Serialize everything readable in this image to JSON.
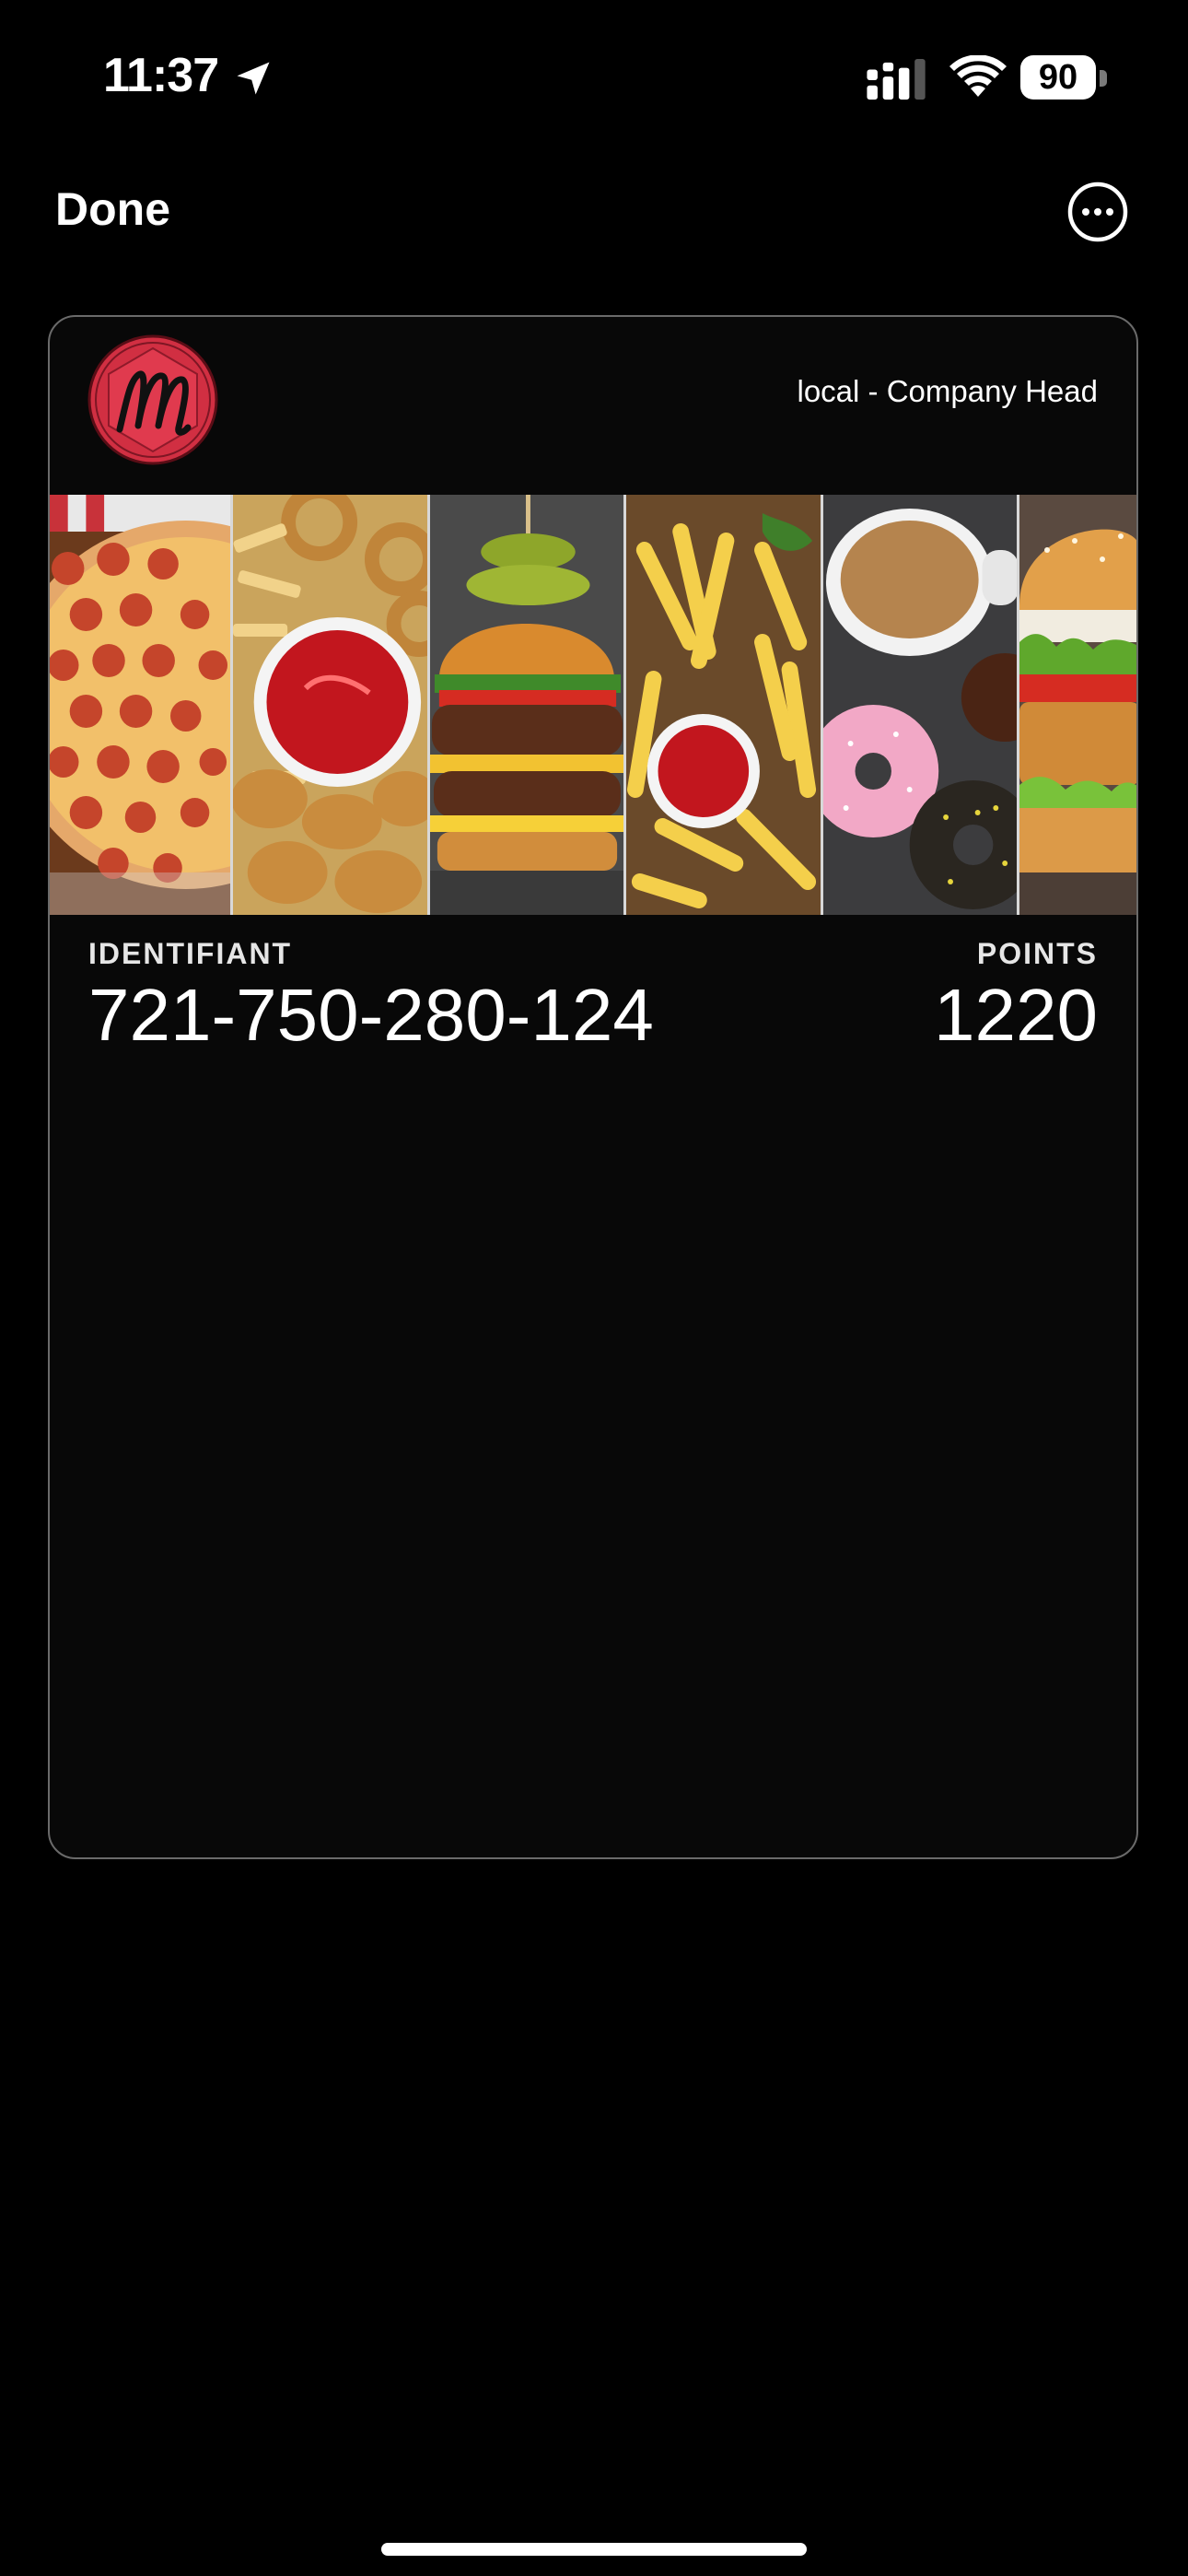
{
  "status_bar": {
    "time": "11:37",
    "battery": "90",
    "icons": [
      "location-arrow-icon",
      "cellular-signal-icon",
      "wifi-icon",
      "battery-icon"
    ]
  },
  "nav": {
    "done_label": "Done",
    "more_icon": "ellipsis-circle-icon"
  },
  "pass": {
    "logo_letter": "M",
    "header": "local - Company Head",
    "strip_panels": [
      "pizza",
      "nuggets-and-onion-rings",
      "burger",
      "fries-with-ketchup",
      "coffee-and-donuts",
      "chicken-burger"
    ],
    "fields": {
      "identifier": {
        "label": "IDENTIFIANT",
        "value": "721-750-280-124"
      },
      "points": {
        "label": "POINTS",
        "value": "1220"
      }
    }
  },
  "colors": {
    "background": "#000000",
    "card_background": "#080808",
    "card_border": "#6a6a6a",
    "logo_red": "#d12f42"
  }
}
